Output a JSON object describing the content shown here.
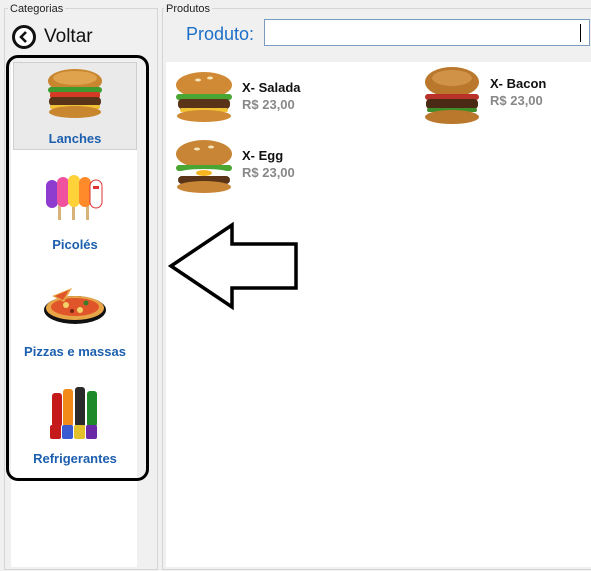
{
  "categories_group": {
    "title": "Categorias"
  },
  "products_group": {
    "title": "Produtos"
  },
  "back_button": {
    "label": "Voltar"
  },
  "search": {
    "label": "Produto:",
    "value": ""
  },
  "categories": [
    {
      "label": "Lanches",
      "icon": "burger-icon",
      "selected": true
    },
    {
      "label": "Picolés",
      "icon": "popsicle-icon",
      "selected": false
    },
    {
      "label": "Pizzas e massas",
      "icon": "pizza-icon",
      "selected": false
    },
    {
      "label": "Refrigerantes",
      "icon": "soda-icon",
      "selected": false
    }
  ],
  "products": [
    {
      "name": "X- Salada",
      "price": "R$ 23,00",
      "icon": "burger-icon"
    },
    {
      "name": "X- Bacon",
      "price": "R$ 23,00",
      "icon": "burger-icon"
    },
    {
      "name": "X- Egg",
      "price": "R$ 23,00",
      "icon": "burger-icon"
    }
  ],
  "colors": {
    "link_blue": "#1c5fae",
    "label_blue": "#1c6fc8",
    "price_gray": "#888888"
  }
}
